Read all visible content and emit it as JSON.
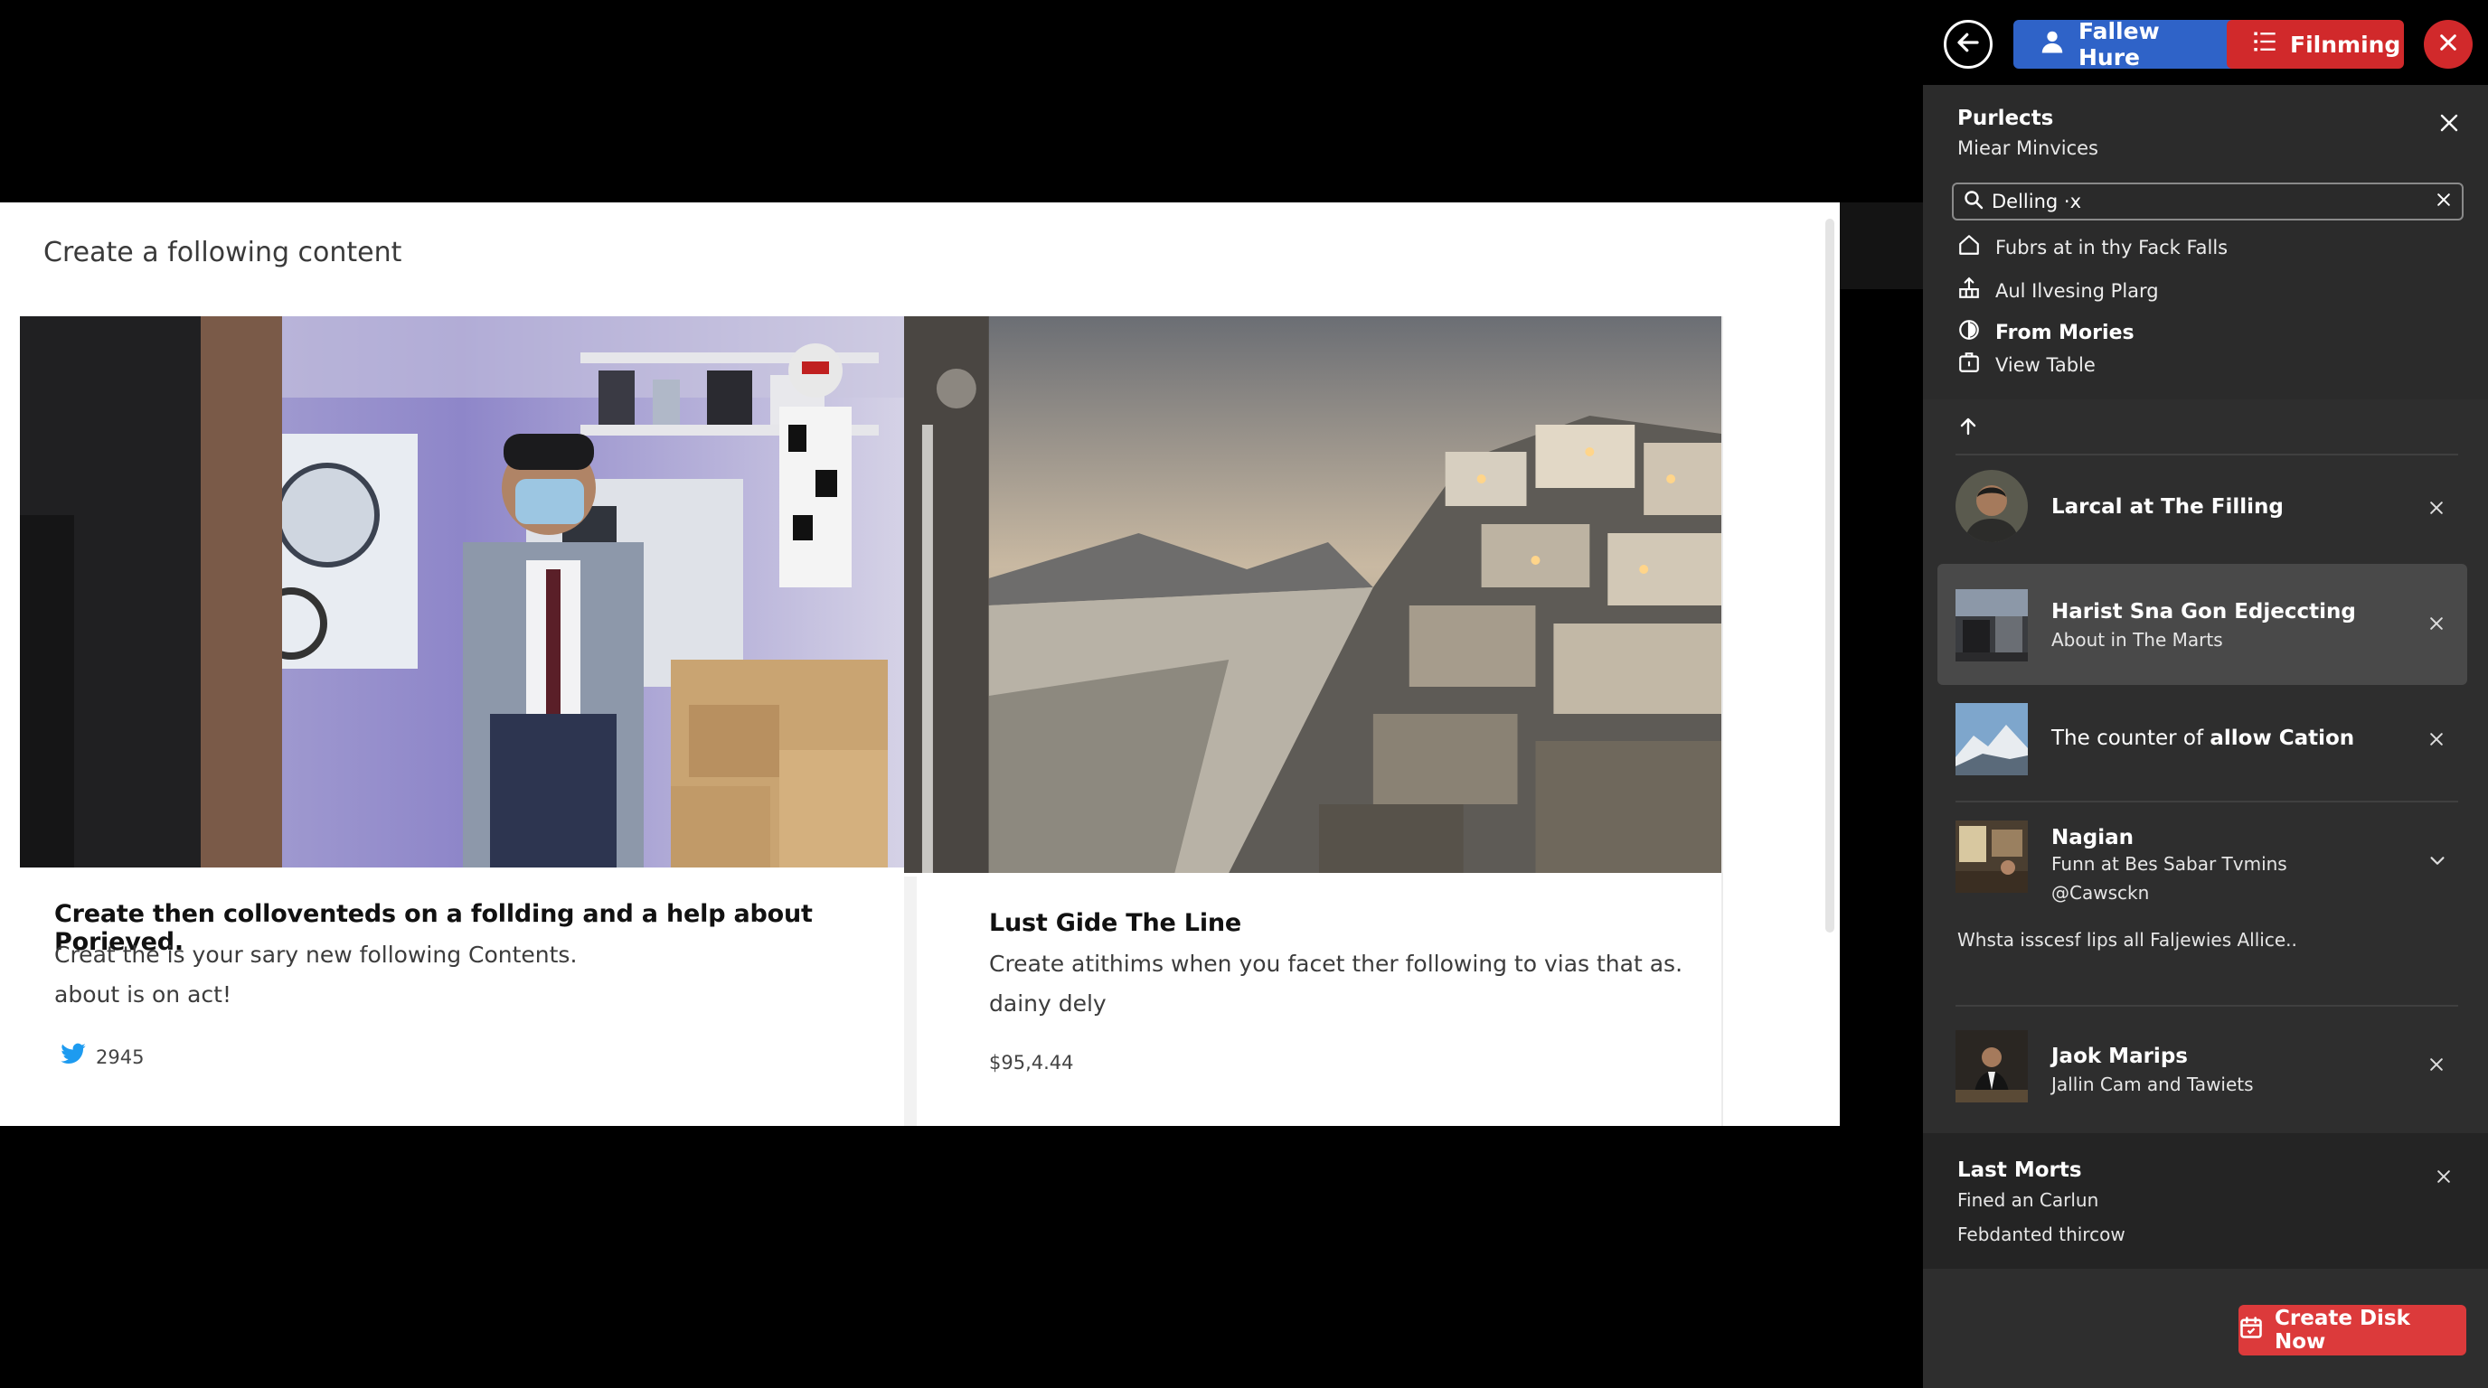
{
  "topbar": {
    "user_label": "Fallew Hure",
    "film_label": "Filnming"
  },
  "main": {
    "heading": "Create a following content",
    "posts": [
      {
        "title": "Create then colloventeds on a follding and a help about Porieved.",
        "line1": "Creat the is your sary new following Contents.",
        "line2": "about is on act!",
        "meta": "2945"
      },
      {
        "title": "Lust Gide The Line",
        "line1": "Create atithims when you facet ther following to vias that as.",
        "line2": "dainy dely",
        "meta": "$95,4.44"
      }
    ]
  },
  "panel": {
    "title": "Purlects",
    "subtitle": "Miear Minvices",
    "search_value": "Delling ·x",
    "menu": [
      {
        "label": "Fubrs at in thy Fack Falls",
        "icon": "home-icon"
      },
      {
        "label": "Aul Ilvesing Plarg",
        "icon": "share-icon"
      },
      {
        "label": "From Mories",
        "icon": "compass-icon"
      },
      {
        "label": "View Table",
        "icon": "table-icon"
      }
    ],
    "items": [
      {
        "title": "Larcal at The Filling"
      },
      {
        "title": "Harist Sna Gon Edjeccting",
        "sub": "About in The Marts"
      },
      {
        "title_plain": "The counter of ",
        "title_bold": "allow Cation"
      },
      {
        "title": "Nagian",
        "sub": "Funn at Bes Sabar Tvmins",
        "sub2": "@Cawsckn",
        "desc": "Whsta isscesf lips all Faljewies Allice.."
      },
      {
        "title": "Jaok Marips",
        "sub": "Jallin Cam and Tawiets"
      },
      {
        "title": "Last Morts",
        "sub": "Fined an Carlun",
        "sub2": "Febdanted thircow"
      }
    ],
    "create_label": "Create Disk Now"
  },
  "colors": {
    "primary_blue": "#2f63c8",
    "accent_red": "#d1292b",
    "create_red": "#dc3a3b",
    "panel_bg": "#2e2e2e",
    "twitter_blue": "#1d9bf0"
  }
}
